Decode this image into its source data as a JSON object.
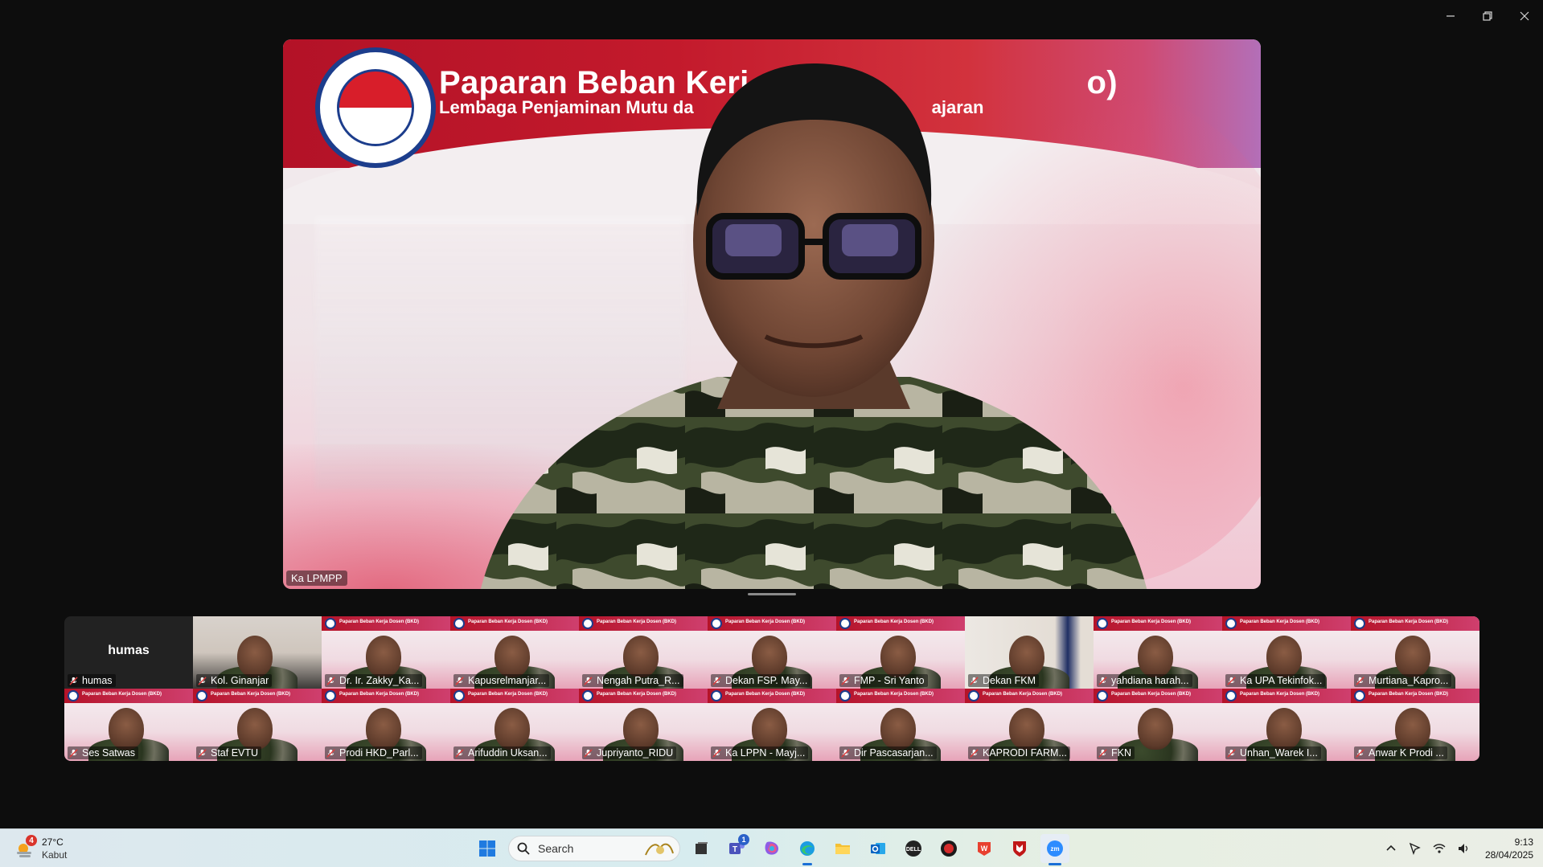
{
  "window": {
    "controls": [
      "minimize",
      "restore",
      "close"
    ]
  },
  "speaker": {
    "banner_title": "Paparan Beban Kerj",
    "banner_title_tail": "o)",
    "banner_subtitle": "Lembaga Penjaminan Mutu da",
    "banner_subtitle_tail": "ajaran",
    "name": "Ka LPMPP"
  },
  "gallery": {
    "tile_banner_text": "Paparan Beban Kerja Dosen (BKD)",
    "row1": [
      {
        "name": "humas",
        "style": "dark",
        "center": "humas"
      },
      {
        "name": "Kol. Ginanjar",
        "style": "office"
      },
      {
        "name": "Dr. Ir. Zakky_Ka...",
        "style": "banner"
      },
      {
        "name": "Kapusrelmanjar...",
        "style": "banner"
      },
      {
        "name": "Nengah Putra_R...",
        "style": "banner"
      },
      {
        "name": "Dekan FSP. May...",
        "style": "banner"
      },
      {
        "name": "FMP - Sri Yanto",
        "style": "banner"
      },
      {
        "name": "Dekan FKM",
        "style": "flag"
      },
      {
        "name": "yahdiana harah...",
        "style": "banner"
      },
      {
        "name": "Ka UPA Tekinfok...",
        "style": "banner"
      },
      {
        "name": "Murtiana_Kapro...",
        "style": "banner"
      }
    ],
    "row2": [
      {
        "name": "Ses Satwas",
        "style": "banner"
      },
      {
        "name": "Staf EVTU",
        "style": "banner"
      },
      {
        "name": "Prodi HKD_Parl...",
        "style": "banner"
      },
      {
        "name": "Arifuddin Uksan...",
        "style": "banner"
      },
      {
        "name": "Jupriyanto_RIDU",
        "style": "banner"
      },
      {
        "name": "Ka LPPN - Mayj...",
        "style": "banner"
      },
      {
        "name": "Dir Pascasarjan...",
        "style": "banner"
      },
      {
        "name": "KAPRODI FARM...",
        "style": "banner"
      },
      {
        "name": "FKN",
        "style": "banner"
      },
      {
        "name": "Unhan_Warek I...",
        "style": "banner"
      },
      {
        "name": "Anwar K Prodi ...",
        "style": "banner"
      }
    ]
  },
  "taskbar": {
    "weather": {
      "temp": "27°C",
      "condition": "Kabut",
      "badge": "4"
    },
    "search_label": "Search",
    "teams_badge": "1",
    "time": "9:13",
    "date": "28/04/2025",
    "apps": [
      "windows-start",
      "search",
      "task-view",
      "teams",
      "copilot",
      "edge",
      "file-explorer",
      "outlook",
      "dell",
      "app-red",
      "wps",
      "mcafee",
      "zoom"
    ]
  }
}
